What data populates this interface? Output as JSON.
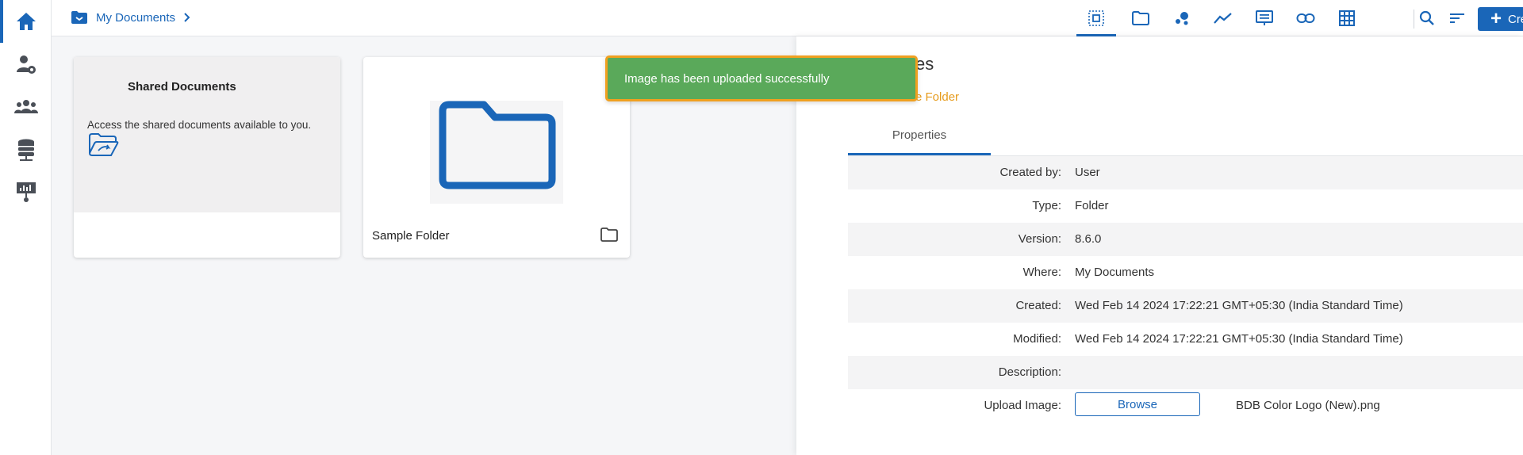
{
  "nav": {
    "items": [
      {
        "name": "home-icon",
        "active": true
      },
      {
        "name": "user-settings-icon"
      },
      {
        "name": "groups-icon"
      },
      {
        "name": "database-icon"
      },
      {
        "name": "presentation-icon"
      }
    ]
  },
  "header": {
    "breadcrumb": "My Documents",
    "toolbar_icons": [
      "select-all-icon",
      "folder-icon",
      "bubble-chart-icon",
      "line-chart-icon",
      "report-icon",
      "link-icon",
      "grid-icon",
      "search-icon",
      "sort-icon"
    ],
    "create_label": "Create"
  },
  "cards": {
    "shared": {
      "title": "Shared Documents",
      "description": "Access the shared documents available to you."
    },
    "folder": {
      "name": "Sample Folder"
    }
  },
  "panel": {
    "heading": "es",
    "subtitle": "e Folder",
    "tab": "Properties",
    "properties": [
      {
        "label": "Created by:",
        "value": "User"
      },
      {
        "label": "Type:",
        "value": "Folder"
      },
      {
        "label": "Version:",
        "value": "8.6.0"
      },
      {
        "label": "Where:",
        "value": "My Documents"
      },
      {
        "label": "Created:",
        "value": "Wed Feb 14 2024 17:22:21 GMT+05:30 (India Standard Time)"
      },
      {
        "label": "Modified:",
        "value": "Wed Feb 14 2024 17:22:21 GMT+05:30 (India Standard Time)"
      },
      {
        "label": "Description:",
        "value": ""
      }
    ],
    "upload": {
      "label": "Upload Image:",
      "button": "Browse",
      "file": "BDB Color Logo (New).png"
    }
  },
  "toast": {
    "message": "Image has been uploaded successfully"
  },
  "colors": {
    "primary": "#1a66b8",
    "toast_bg": "#5aa95a",
    "toast_border": "#f0a020",
    "accent_orange": "#e69b1c"
  }
}
